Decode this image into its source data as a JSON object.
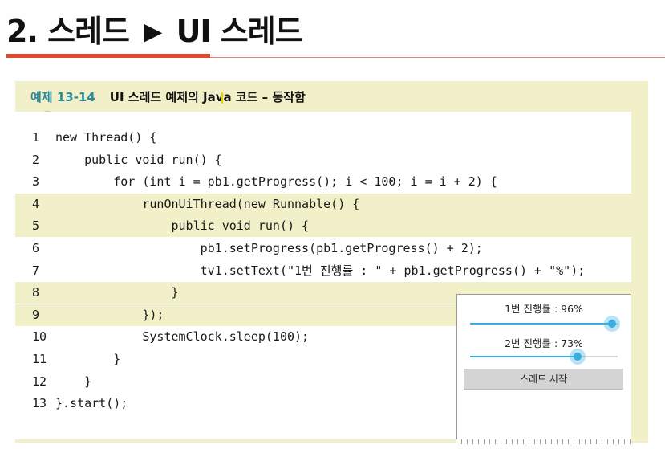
{
  "heading": {
    "number": "2.",
    "section": "스레드",
    "arrow": "▶",
    "subsection": "UI 스레드"
  },
  "example": {
    "number": "예제 13-14",
    "title": "UI 스레드 예제의 Java 코드 – 동작함"
  },
  "code_lines": [
    {
      "n": "1",
      "text": "new Thread() {",
      "highlight": false
    },
    {
      "n": "2",
      "text": "    public void run() {",
      "highlight": false
    },
    {
      "n": "3",
      "text": "        for (int i = pb1.getProgress(); i < 100; i = i + 2) {",
      "highlight": false
    },
    {
      "n": "4",
      "text": "            runOnUiThread(new Runnable() {",
      "highlight": true
    },
    {
      "n": "5",
      "text": "                public void run() {",
      "highlight": true
    },
    {
      "n": "6",
      "text": "                    pb1.setProgress(pb1.getProgress() + 2);",
      "highlight": false
    },
    {
      "n": "7",
      "text": "                    tv1.setText(\"1번 진행률 : \" + pb1.getProgress() + \"%\");",
      "highlight": false
    },
    {
      "n": "8",
      "text": "                }",
      "highlight": true
    },
    {
      "n": "9",
      "text": "            });",
      "highlight": true
    },
    {
      "n": "10",
      "text": "            SystemClock.sleep(100);",
      "highlight": false
    },
    {
      "n": "11",
      "text": "        }",
      "highlight": false
    },
    {
      "n": "12",
      "text": "    }",
      "highlight": false
    },
    {
      "n": "13",
      "text": "}.start();",
      "highlight": false
    }
  ],
  "app": {
    "progress1_label": "1번 진행률 : 96%",
    "progress1_value": 0.96,
    "progress2_label": "2번 진행률 : 73%",
    "progress2_value": 0.73,
    "start_button": "스레드 시작"
  },
  "colors": {
    "accent_red": "#e04a2f",
    "highlight": "#f2f0c8",
    "example_number": "#2a8a9e",
    "progress": "#39aee0"
  }
}
